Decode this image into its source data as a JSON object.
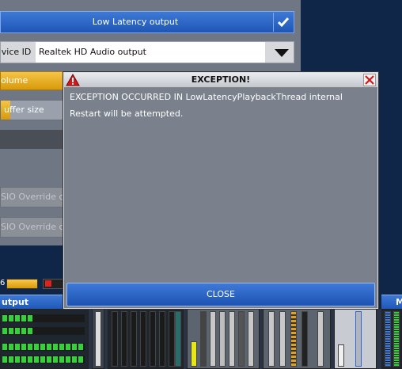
{
  "settings": {
    "low_latency_label": "Low Latency output",
    "device_label": "evice ID",
    "device_value": "Realtek HD Audio output",
    "volume_label": "olume",
    "buffer_label": "uffer size",
    "asio_override_1": "SIO Override cha",
    "asio_override_2": "SIO Override cha",
    "level_number": "6"
  },
  "bottom": {
    "output_label": "utput",
    "right_label": "M"
  },
  "dialog": {
    "title": "EXCEPTION!",
    "message_line1": "EXCEPTION OCCURRED IN LowLatencyPlaybackThread internal",
    "message_line2": "Restart will be attempted.",
    "close_label": "CLOSE"
  },
  "icons": {
    "check": "check-icon",
    "dropdown": "chevron-down-icon",
    "warning": "warning-icon",
    "close": "close-icon"
  },
  "colors": {
    "accent_blue": "#1f56b5",
    "orange": "#d89a0a",
    "meter_green": "#35d13a",
    "danger_red": "#d22222"
  }
}
